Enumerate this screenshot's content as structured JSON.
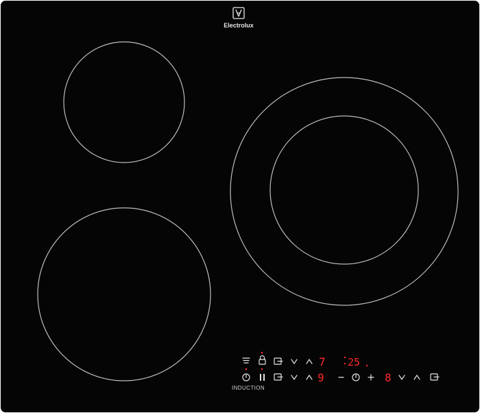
{
  "brand": {
    "name": "Electrolux"
  },
  "label": {
    "induction": "INDUCTION"
  },
  "display": {
    "zone_upper_level": "7",
    "zone_lower_level": "9",
    "timer": "25",
    "timer_zone_level": "8"
  },
  "colors": {
    "glass": "#050505",
    "zone_outline": "#bdbdbd",
    "led_red": "#ff2a2a",
    "icon_white": "#e6e6e6"
  },
  "icons": {
    "brand_logo": "electrolux-logo-icon",
    "hob_to_hood": "hob2hood-icon",
    "lock": "lock-icon",
    "power": "power-icon",
    "pause": "pause-icon",
    "zone_select": "zone-select-icon",
    "decrease": "chevron-down-icon",
    "increase": "chevron-up-icon",
    "timer_minus": "minus-icon",
    "timer_clock": "clock-icon",
    "timer_plus": "plus-icon"
  }
}
